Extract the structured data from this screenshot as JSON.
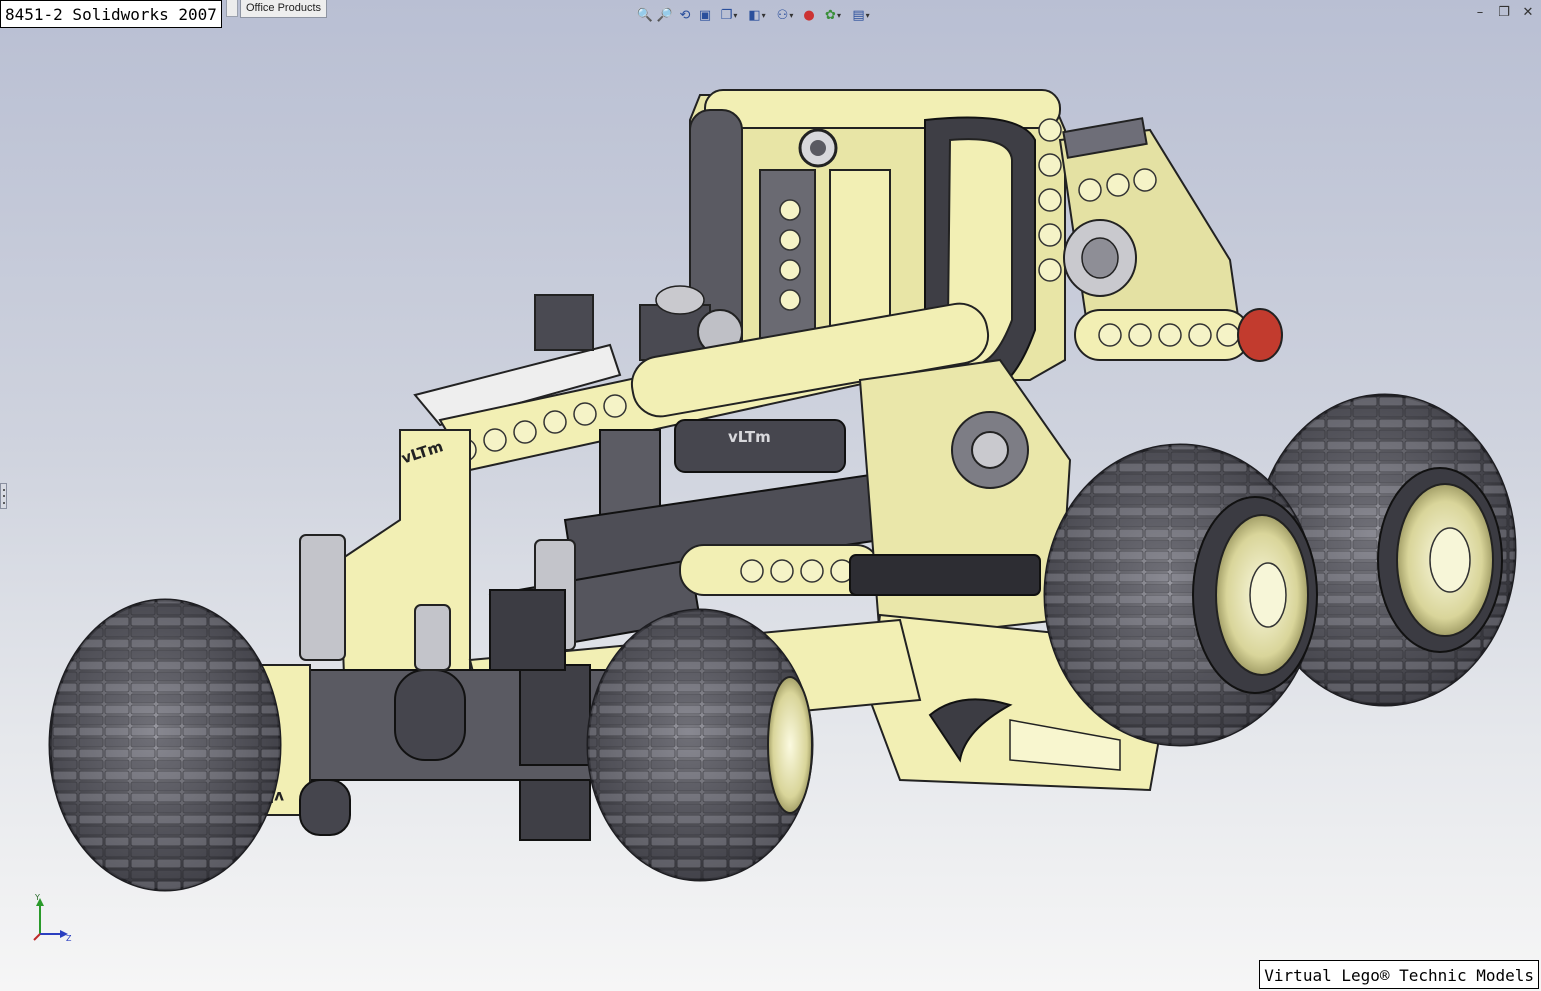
{
  "window": {
    "title_label": "8451-2 Solidworks 2007",
    "tab_label": "Office Products",
    "watermark": "Virtual Lego® Technic Models"
  },
  "model": {
    "part_engraving": "vLTm",
    "part_engraving_short": "vLT"
  },
  "toolbar": {
    "icons": [
      "zoom-to-fit-icon",
      "zoom-to-area-icon",
      "rotate-view-icon",
      "section-view-icon",
      "view-orientation-icon",
      "display-style-icon",
      "hide-show-items-icon",
      "edit-appearance-icon",
      "apply-scene-icon",
      "view-settings-icon"
    ]
  },
  "triad": {
    "y_label": "Y",
    "z_label": "Z"
  },
  "colors": {
    "beam_yellow": "#f2efb4",
    "dark_grey": "#4a4a52",
    "tire_grey": "#5b5b62",
    "light_grey": "#b9bcc4",
    "background_top": "#b9bfd3",
    "background_bottom": "#f6f6f6"
  }
}
